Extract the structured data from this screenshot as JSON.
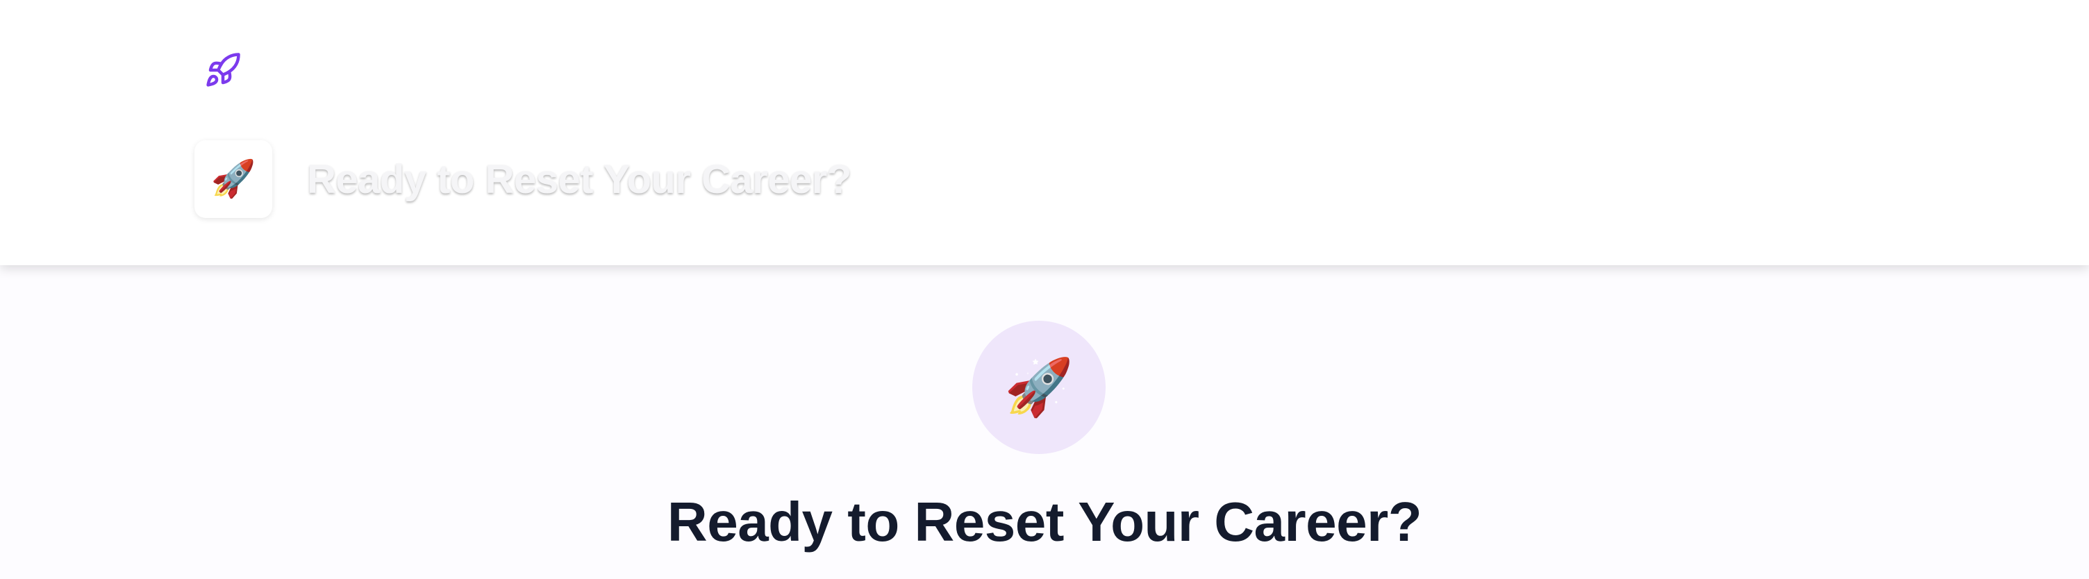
{
  "header": {
    "logo_icon": "rocket-outline-icon",
    "emoji_icon": "rocket-emoji-icon",
    "emoji": "🚀",
    "title": "Ready to Reset Your Career?"
  },
  "hero": {
    "emoji_icon": "rocket-emoji-icon",
    "emoji": "🚀",
    "title": "Ready to Reset Your Career?"
  },
  "colors": {
    "accent": "#7c3aed",
    "hero_circle": "#efe6fb",
    "title_text": "#141b2d"
  }
}
